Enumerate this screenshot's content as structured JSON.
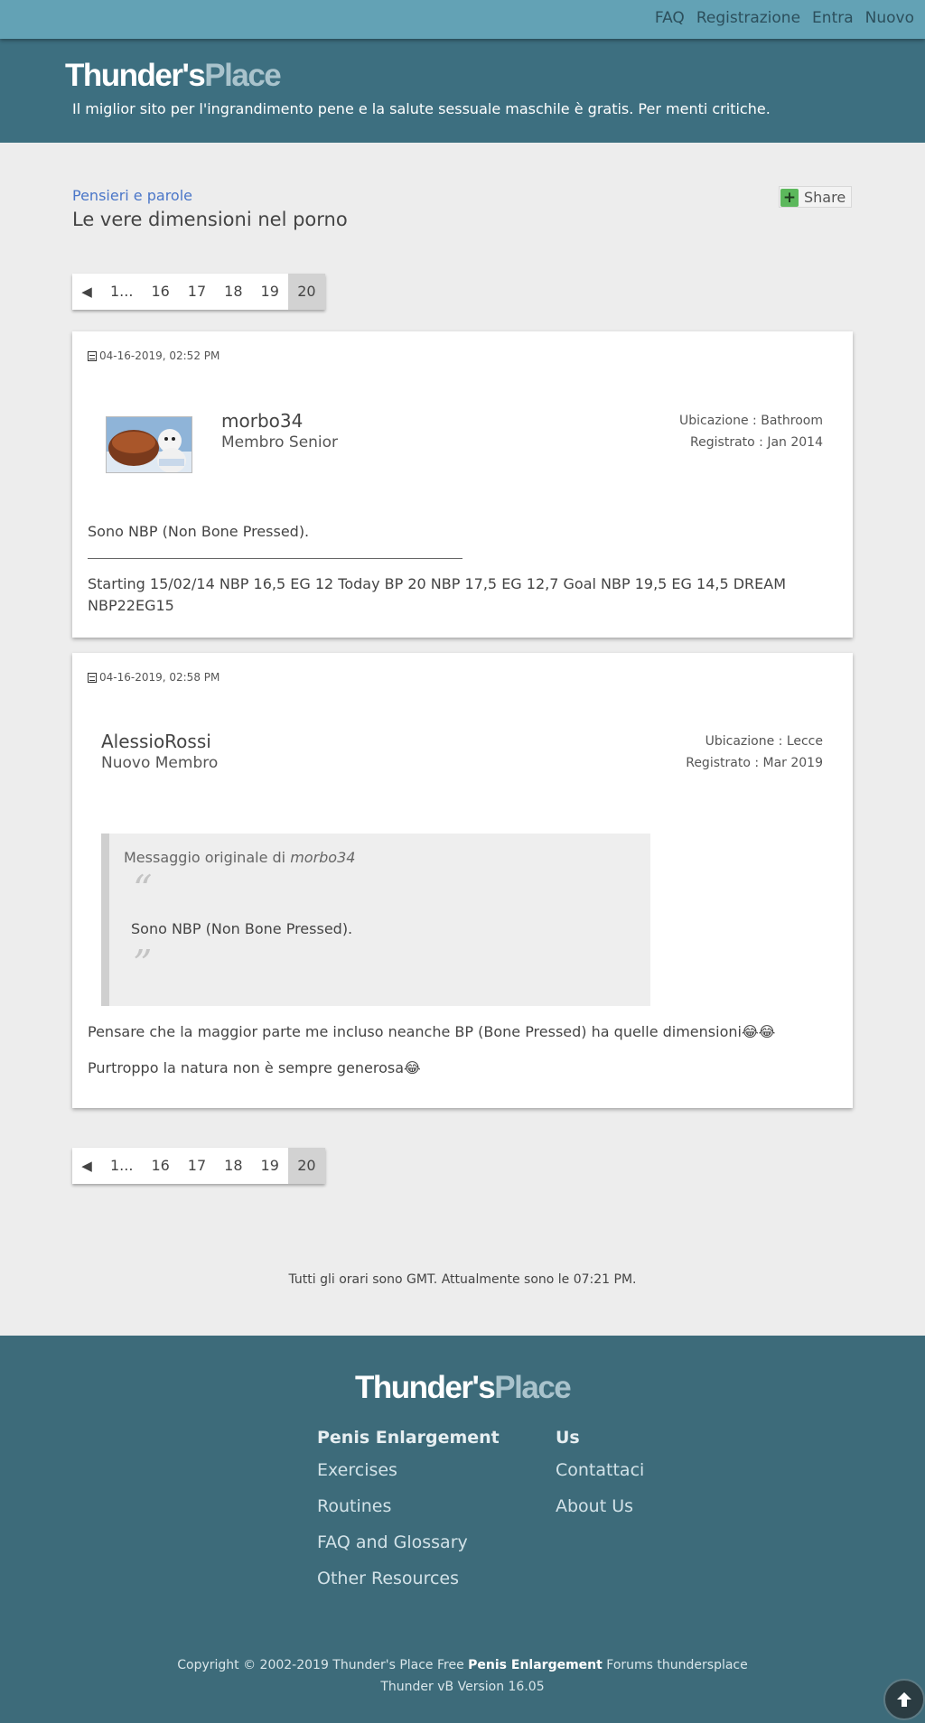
{
  "nav": {
    "links": [
      "FAQ",
      "Registrazione",
      "Entra",
      "Nuovo"
    ]
  },
  "header": {
    "logo_part1": "Thunder's",
    "logo_part2": "Place",
    "tagline": "Il miglior sito per l'ingrandimento pene e la salute sessuale maschile è gratis. Per menti critiche."
  },
  "thread": {
    "breadcrumb": "Pensieri e parole",
    "title": "Le vere dimensioni nel porno",
    "share_label": "Share"
  },
  "pagination": {
    "prev": "◀",
    "first": "1...",
    "pages": [
      "16",
      "17",
      "18",
      "19"
    ],
    "current": "20"
  },
  "posts": [
    {
      "date": "04-16-2019, 02:52 PM",
      "username": "morbo34",
      "rank": "Membro Senior",
      "location": "Ubicazione : Bathroom",
      "registered": "Registrato : Jan 2014",
      "text": "Sono NBP (Non Bone Pressed).",
      "signature": "Starting 15/02/14 NBP 16,5 EG 12 Today BP 20 NBP 17,5 EG 12,7 Goal NBP 19,5 EG 14,5 DREAM NBP22EG15"
    },
    {
      "date": "04-16-2019, 02:58 PM",
      "username": "AlessioRossi",
      "rank": "Nuovo Membro",
      "location": "Ubicazione : Lecce",
      "registered": "Registrato : Mar 2019",
      "quote_prefix": "Messaggio originale di",
      "quote_author": "morbo34",
      "quote_text": "Sono NBP (Non Bone Pressed).",
      "quote_open": "“",
      "quote_close": "”",
      "line1": "Pensare che la maggior parte me incluso neanche BP (Bone Pressed) ha quelle dimensioni😂😂",
      "line2": "Purtroppo la natura non è sempre generosa😂"
    }
  ],
  "timezone": "Tutti gli orari sono GMT. Attualmente sono le 07:21 PM.",
  "footer": {
    "col1_title": "Penis Enlargement",
    "col1_links": [
      "Exercises",
      "Routines",
      "FAQ and Glossary",
      "Other Resources"
    ],
    "col2_title": "Us",
    "col2_links": [
      "Contattaci",
      "About Us"
    ],
    "copy_prefix": "Copyright © 2002-2019 Thunder's Place Free",
    "copy_bold": "Penis Enlargement",
    "copy_suffix": "Forums thundersplace",
    "version": "Thunder vB Version 16.05"
  },
  "icons": {
    "share": "plus-icon",
    "date": "document-icon",
    "scroll": "arrow-up-icon"
  }
}
